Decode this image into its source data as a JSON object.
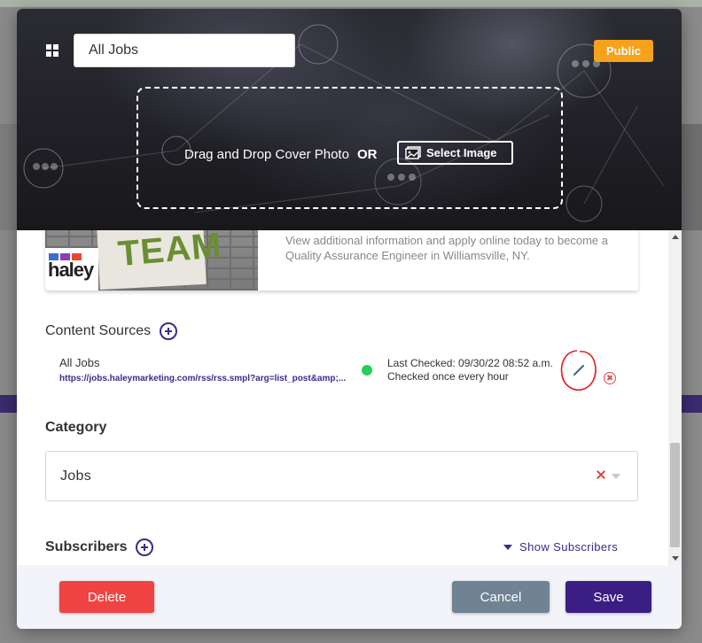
{
  "modal": {
    "title_value": "All Jobs",
    "visibility_badge": "Public",
    "dropzone": {
      "text": "Drag and Drop Cover Photo",
      "or_text": "OR",
      "select_image_label": "Select Image"
    }
  },
  "post_preview": {
    "thumbnail_text": "TEAM",
    "logo_text": "haley",
    "description": "View additional information and apply online today to become a Quality Assurance Engineer in Williamsville, NY."
  },
  "content_sources": {
    "heading": "Content Sources",
    "items": [
      {
        "name": "All Jobs",
        "url": "https://jobs.haleymarketing.com/rss/rss.smpl?arg=list_post&amp;...",
        "last_checked": "Last Checked: 09/30/22 08:52 a.m.",
        "frequency": "Checked once every hour",
        "status_color": "#23d05a"
      }
    ]
  },
  "category": {
    "heading": "Category",
    "selected": "Jobs"
  },
  "subscribers": {
    "heading": "Subscribers",
    "toggle_label": "Show Subscribers"
  },
  "footer": {
    "delete_label": "Delete",
    "cancel_label": "Cancel",
    "save_label": "Save"
  },
  "colors": {
    "accent": "#3d2a8c",
    "public_badge": "#f7a21b",
    "delete": "#f04343",
    "cancel": "#6f8392",
    "save": "#3a1e84"
  },
  "icons": [
    "grid-icon",
    "image-icon",
    "plus-circle-icon",
    "pencil-icon",
    "remove-circle-icon",
    "clear-icon",
    "caret-down-icon"
  ]
}
